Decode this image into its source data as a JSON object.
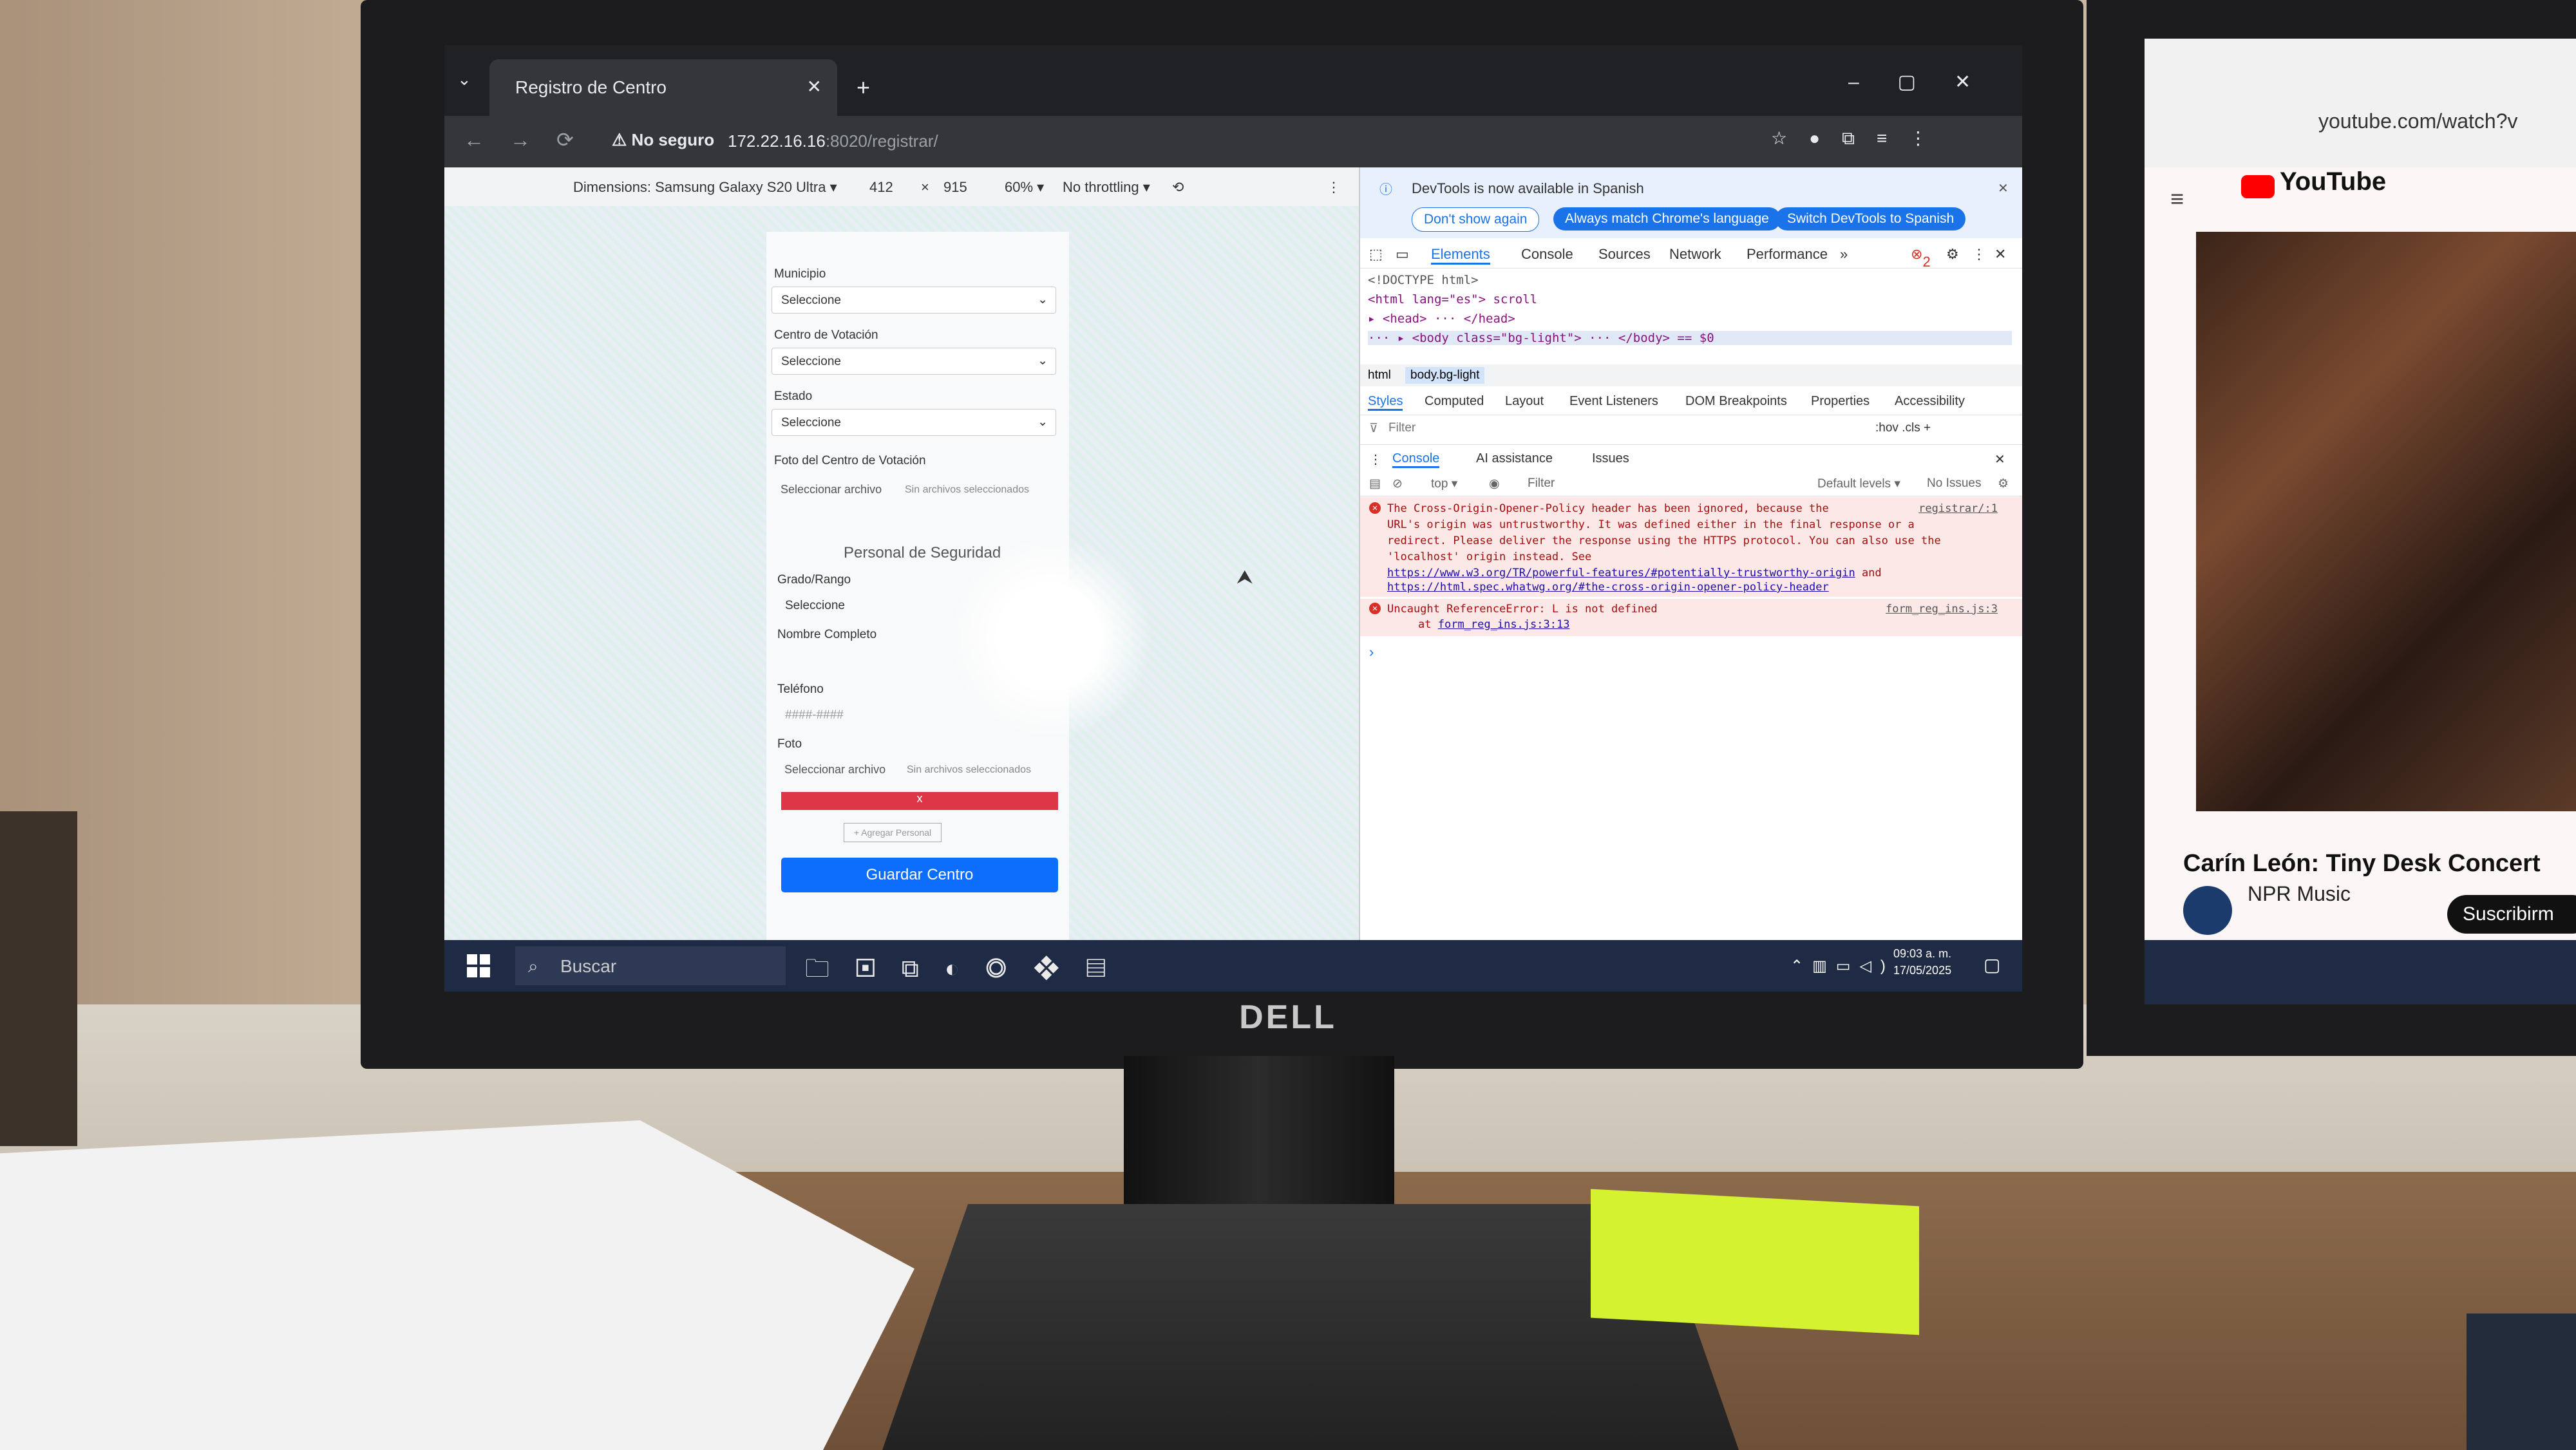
{
  "browser": {
    "tab_title": "Registro de Centro",
    "new_tab": "+",
    "security_label": "No seguro",
    "url_host": "172.22.16.16",
    "url_path": ":8020/registrar/"
  },
  "device_toolbar": {
    "dimensions_label": "Dimensions: Samsung Galaxy S20 Ultra ▾",
    "width": "412",
    "times": "×",
    "height": "915",
    "zoom": "60% ▾",
    "throttling": "No throttling ▾"
  },
  "form": {
    "municipio_label": "Municipio",
    "municipio_value": "Seleccione",
    "centro_label": "Centro de Votación",
    "centro_value": "Seleccione",
    "estado_label": "Estado",
    "estado_value": "Seleccione",
    "foto_centro_label": "Foto del Centro de Votación",
    "select_file": "Seleccionar archivo",
    "no_files": "Sin archivos seleccionados",
    "section_title": "Personal de Seguridad",
    "grado_label": "Grado/Rango",
    "grado_value": "Seleccione",
    "nombre_label": "Nombre Completo",
    "telefono_label": "Teléfono",
    "telefono_placeholder": "####-####",
    "foto_label": "Foto",
    "remove_button": "x",
    "add_button": "+ Agregar Personal",
    "save_button": "Guardar Centro"
  },
  "devtools": {
    "banner_text": "DevTools is now available in Spanish",
    "btn_dont": "Don't show again",
    "btn_match": "Always match Chrome's language",
    "btn_switch": "Switch DevTools to Spanish",
    "tabs": [
      "Elements",
      "Console",
      "Sources",
      "Network",
      "Performance",
      "»"
    ],
    "error_badge": "2",
    "dom_lines": [
      "<!DOCTYPE html>",
      "<html lang=\"es\"> scroll",
      "▸ <head> ··· </head>",
      "··· ▸ <body class=\"bg-light\"> ··· </body> == $0"
    ],
    "breadcrumbs": [
      "html",
      "body.bg-light"
    ],
    "style_tabs": [
      "Styles",
      "Computed",
      "Layout",
      "Event Listeners",
      "DOM Breakpoints",
      "Properties",
      "Accessibility"
    ],
    "filter_placeholder": "Filter",
    "filter_extras": ":hov  .cls  +",
    "console_tabs": [
      "Console",
      "AI assistance",
      "Issues"
    ],
    "console_context": "top ▾",
    "console_filter": "Filter",
    "default_levels": "Default levels ▾",
    "no_issues": "No Issues",
    "error1_lines": [
      "The Cross-Origin-Opener-Policy header has been ignored, because the",
      "URL's origin was untrustworthy. It was defined either in the final response or a",
      "redirect. Please deliver the response using the HTTPS protocol. You can also use the",
      "'localhost' origin instead. See"
    ],
    "error1_link1": "https://www.w3.org/TR/powerful-features/#potentially-trustworthy-origin",
    "error1_and": "and",
    "error1_link2": "https://html.spec.whatwg.org/#the-cross-origin-opener-policy-header",
    "error1_source": "registrar/:1",
    "error2_text": "Uncaught ReferenceError: L is not defined",
    "error2_at": "at",
    "error2_link": "form_reg_ins.js:3:13",
    "error2_source": "form_reg_ins.js:3",
    "prompt": "›"
  },
  "taskbar": {
    "search_placeholder": "Buscar",
    "time": "09:03 a. m.",
    "date": "17/05/2025"
  },
  "monitor_brand": "DELL",
  "youtube": {
    "url": "youtube.com/watch?v",
    "logo": "YouTube",
    "video_title": "Carín León: Tiny Desk Concert",
    "channel": "NPR Music",
    "subscribe": "Suscribirm"
  }
}
